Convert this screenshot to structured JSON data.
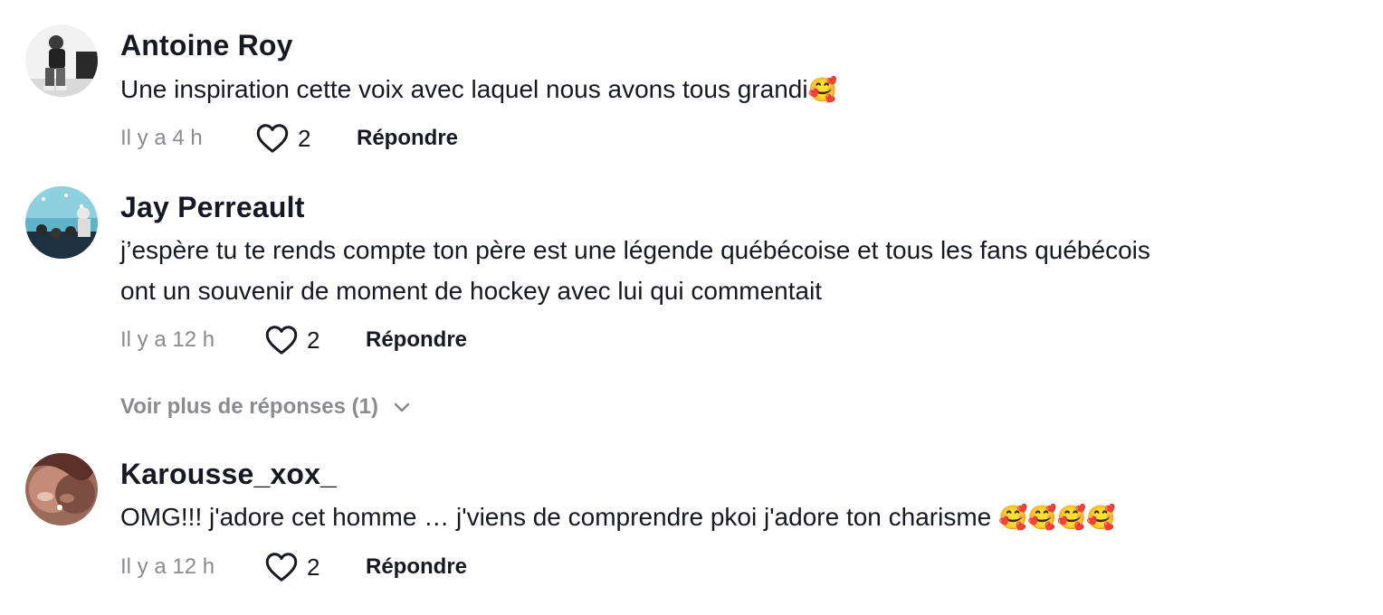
{
  "comments": [
    {
      "username": "Antoine Roy",
      "text": "Une inspiration cette voix avec laquel nous avons tous grandi",
      "emoji": "🥰",
      "time": "Il y a 4 h",
      "likes": "2",
      "reply_label": "Répondre",
      "avatar_icon": "user-avatar-photo"
    },
    {
      "username": "Jay Perreault",
      "text_line1": "j’espère tu te rends compte ton père est une légende québécoise et tous les fans québécois",
      "text_line2": "ont un souvenir de moment de hockey avec lui qui commentait",
      "time": "Il y a 12 h",
      "likes": "2",
      "reply_label": "Répondre",
      "more_replies": "Voir plus de réponses (1)",
      "avatar_icon": "user-avatar-photo"
    },
    {
      "username": "Karousse_xox_",
      "text": "OMG!!! j'adore cet homme … j'viens de comprendre pkoi j'adore ton charisme ",
      "emoji": "🥰🥰🥰🥰",
      "time": "Il y a 12 h",
      "likes": "2",
      "reply_label": "Répondre",
      "avatar_icon": "user-avatar-photo"
    }
  ],
  "colors": {
    "text": "#161823",
    "secondary": "#8a8b91"
  },
  "icons": {
    "like": "heart-outline-icon",
    "expand": "chevron-down-icon"
  }
}
